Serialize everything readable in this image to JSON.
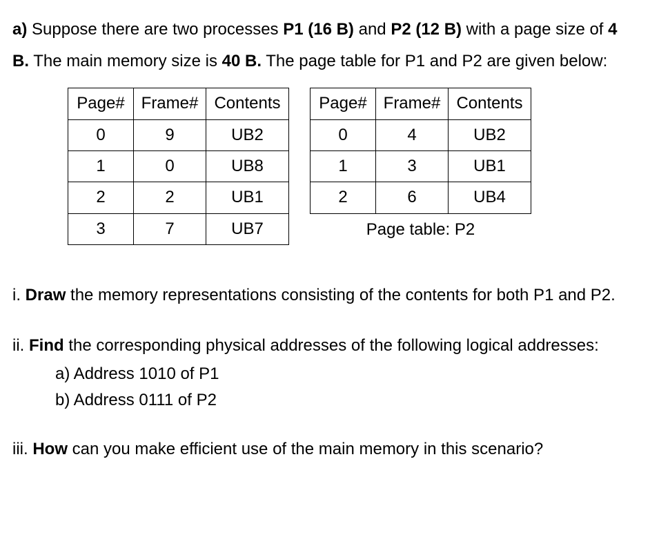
{
  "intro": {
    "label_a": "a)",
    "part1": " Suppose there are two processes ",
    "p1": "P1 (16 B)",
    "part2": " and ",
    "p2": "P2 (12 B)",
    "part3": " with a page size of ",
    "page_size": "4 B.",
    "part4": " The main memory size is ",
    "mem_size": "40 B.",
    "part5": " The page table for P1 and P2 are given below:"
  },
  "table1": {
    "headers": [
      "Page#",
      "Frame#",
      "Contents"
    ],
    "rows": [
      [
        "0",
        "9",
        "UB2"
      ],
      [
        "1",
        "0",
        "UB8"
      ],
      [
        "2",
        "2",
        "UB1"
      ],
      [
        "3",
        "7",
        "UB7"
      ]
    ]
  },
  "table2": {
    "headers": [
      "Page#",
      "Frame#",
      "Contents"
    ],
    "rows": [
      [
        "0",
        "4",
        "UB2"
      ],
      [
        "1",
        "3",
        "UB1"
      ],
      [
        "2",
        "6",
        "UB4"
      ]
    ],
    "caption": "Page table: P2"
  },
  "questions": {
    "q1": {
      "num": "i. ",
      "bold": "Draw",
      "text": " the memory representations consisting of the contents for both P1 and P2."
    },
    "q2": {
      "num": "ii. ",
      "bold": "Find",
      "text": " the corresponding physical addresses of the following logical addresses:",
      "sub_a": "a) Address 1010 of P1",
      "sub_b": "b) Address 0111 of P2"
    },
    "q3": {
      "num": "iii. ",
      "bold": "How",
      "text": " can you make efficient use of the main memory in this scenario?"
    }
  }
}
